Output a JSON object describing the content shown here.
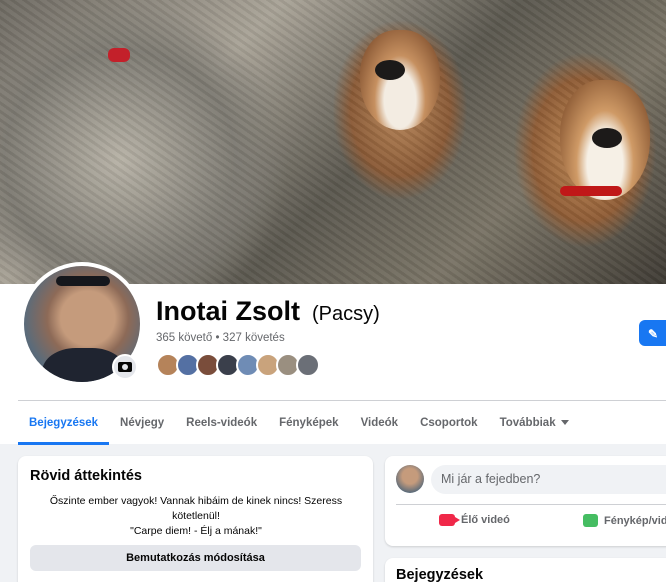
{
  "profile": {
    "name": "Inotai Zsolt",
    "nickname": "(Pacsy)",
    "stats": "365 követő • 327 követés"
  },
  "tabs": [
    "Bejegyzések",
    "Névjegy",
    "Reels-videók",
    "Fényképek",
    "Videók",
    "Csoportok",
    "Továbbiak"
  ],
  "intro": {
    "title": "Rövid áttekintés",
    "bio_line1": "Őszinte ember vagyok! Vannak hibáim de kinek nincs! Szeress",
    "bio_line2": "kötetlenül!",
    "bio_line3": "\"Carpe diem! - Élj a mának!\"",
    "edit_button": "Bemutatkozás módosítása"
  },
  "composer": {
    "placeholder": "Mi jár a fejedben?",
    "live_label": "Élő videó",
    "photo_label": "Fénykép/vid"
  },
  "posts": {
    "title": "Bejegyzések"
  },
  "colors": {
    "accent": "#1877f2",
    "live": "#f02849",
    "photo": "#45bd62"
  },
  "icons": {
    "camera": "camera-icon",
    "caret": "caret-down-icon",
    "edit": "edit-icon"
  }
}
